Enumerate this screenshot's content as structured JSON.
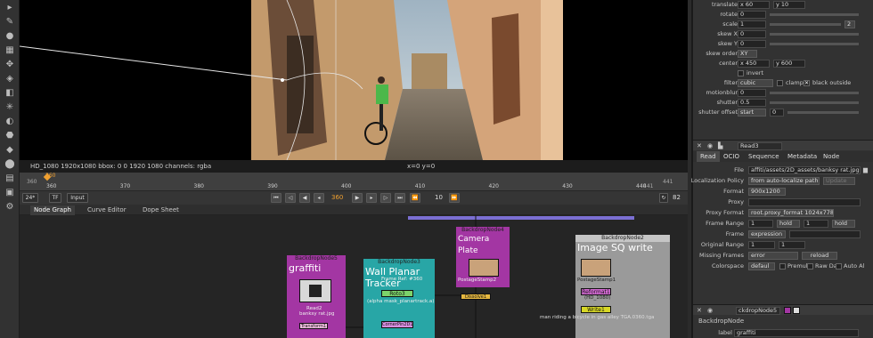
{
  "viewer": {
    "info_text": "HD_1080 1920x1080  bbox: 0 0 1920 1080 channels: rgba",
    "coords": "x=0 y=0",
    "photo_sky_color": "#b8c7cf",
    "photo_wall_color": "#c9a27a"
  },
  "timeline": {
    "ticks": [
      "360",
      "370",
      "380",
      "390",
      "400",
      "410",
      "420",
      "430",
      "440"
    ],
    "start_label": "360",
    "end_label": "441",
    "current_frame_marker": "360",
    "end_frame_marker": "441"
  },
  "transport": {
    "fps": "24*",
    "tf": "TF",
    "mode": "Input",
    "frame": "360",
    "step": "10",
    "end": "82"
  },
  "tabs": [
    {
      "label": "Node Graph",
      "active": true
    },
    {
      "label": "Curve Editor",
      "active": false
    },
    {
      "label": "Dope Sheet",
      "active": false
    }
  ],
  "graph": {
    "backdrops": [
      {
        "head": "BackdropNode5",
        "label": "graffiti",
        "color": "#a336a3"
      },
      {
        "head": "BackdropNode3",
        "label": "Wall Planar Tracker",
        "color": "#28a6a6"
      },
      {
        "head": "BackdropNode4",
        "label": "Camera Plate",
        "color": "#a336a3"
      },
      {
        "head": "BackdropNode2",
        "label": "Image SQ write",
        "color": "#9a9a9a"
      }
    ],
    "nodes": {
      "read2": "Read2",
      "read2_sub": "banksy rat.jpg",
      "frame_ref": "Frame Ref: #360",
      "roto3": "Roto3",
      "roto3_sub": "(alpha mask_planartrack.a)",
      "postage_stamp2": "PostageStamp2",
      "postage_stamp1": "PostageStamp1",
      "reformat1": "Reformat1",
      "reformat1_sub": "(HD_1080)",
      "write1": "Write1",
      "write1_path": "man riding a bicycle in gas alley TGA.0360.tga",
      "cornerpin": "CornerPin2D1",
      "dissolve": "Dissolve1",
      "transform": "Transform1"
    }
  },
  "transform_props": {
    "translate_label": "translate",
    "translate_x": "x 60",
    "translate_y": "y 10",
    "rotate_label": "rotate",
    "rotate": "0",
    "scale_label": "scale",
    "scale": "1",
    "scale_count": "2",
    "skewx_label": "skew X",
    "skewx": "0",
    "skewy_label": "skew Y",
    "skewy": "0",
    "skeworder_label": "skew order",
    "skeworder": "XY",
    "center_label": "center",
    "center_x": "x 450",
    "center_y": "y 600",
    "invert": "invert",
    "filter_label": "filter",
    "filter": "cubic",
    "clamp": "clamp",
    "black_outside": "black outside",
    "motionblur_label": "motionblur",
    "motionblur": "0",
    "shutter_label": "shutter",
    "shutter": "0.5",
    "shutter_offset_label": "shutter offset",
    "shutter_offset": "start",
    "shutter_offset_value": "0"
  },
  "read_panel": {
    "node_name": "Read3",
    "tabs": [
      "Read",
      "OCIO",
      "Sequence",
      "Metadata",
      "Node"
    ],
    "file_label": "File",
    "file": "affiti/assets/2D_assets/banksy rat.jpg",
    "localization_label": "Localization Policy",
    "localization": "from auto-localize path",
    "update": "Update",
    "format_label": "Format",
    "format": "900x1200",
    "proxy_label": "Proxy",
    "proxy_format_label": "Proxy Format",
    "proxy_format": "root.proxy_format 1024x778",
    "frame_range_label": "Frame Range",
    "frame_range_start": "1",
    "frame_range_start_mode": "hold",
    "frame_range_end": "1",
    "frame_range_end_mode": "hold",
    "frame_label": "Frame",
    "frame": "expression",
    "original_range_label": "Original Range",
    "original_range_start": "1",
    "original_range_end": "1",
    "missing_frames_label": "Missing Frames",
    "missing_frames": "error",
    "reload": "reload",
    "colorspace_label": "Colorspace",
    "colorspace": "defaul",
    "premult": "Premul",
    "raw": "Raw Da",
    "auto_alpha": "Auto Al"
  },
  "backdrop_panel": {
    "node_name": "ckdropNode5",
    "tab": "BackdropNode",
    "label_label": "label",
    "label_value": "graffiti"
  }
}
